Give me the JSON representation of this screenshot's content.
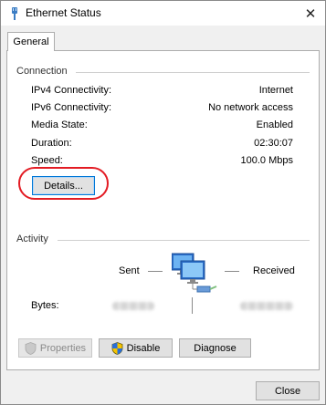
{
  "window": {
    "title": "Ethernet Status",
    "close_glyph": "✕"
  },
  "tabs": [
    {
      "label": "General",
      "selected": true
    }
  ],
  "connection": {
    "heading": "Connection",
    "rows": [
      {
        "label": "IPv4 Connectivity:",
        "value": "Internet"
      },
      {
        "label": "IPv6 Connectivity:",
        "value": "No network access"
      },
      {
        "label": "Media State:",
        "value": "Enabled"
      },
      {
        "label": "Duration:",
        "value": "02:30:07"
      },
      {
        "label": "Speed:",
        "value": "100.0 Mbps"
      }
    ],
    "details_button": "Details..."
  },
  "activity": {
    "heading": "Activity",
    "sent_label": "Sent",
    "received_label": "Received",
    "bytes_label": "Bytes:"
  },
  "buttons": {
    "properties": "Properties",
    "disable": "Disable",
    "diagnose": "Diagnose",
    "close": "Close"
  },
  "icons": {
    "title": "ethernet-cable-icon",
    "network": "network-computers-icon",
    "shield": "uac-shield-icon"
  },
  "colors": {
    "highlight": "#e31b23",
    "accent": "#0078d7"
  }
}
